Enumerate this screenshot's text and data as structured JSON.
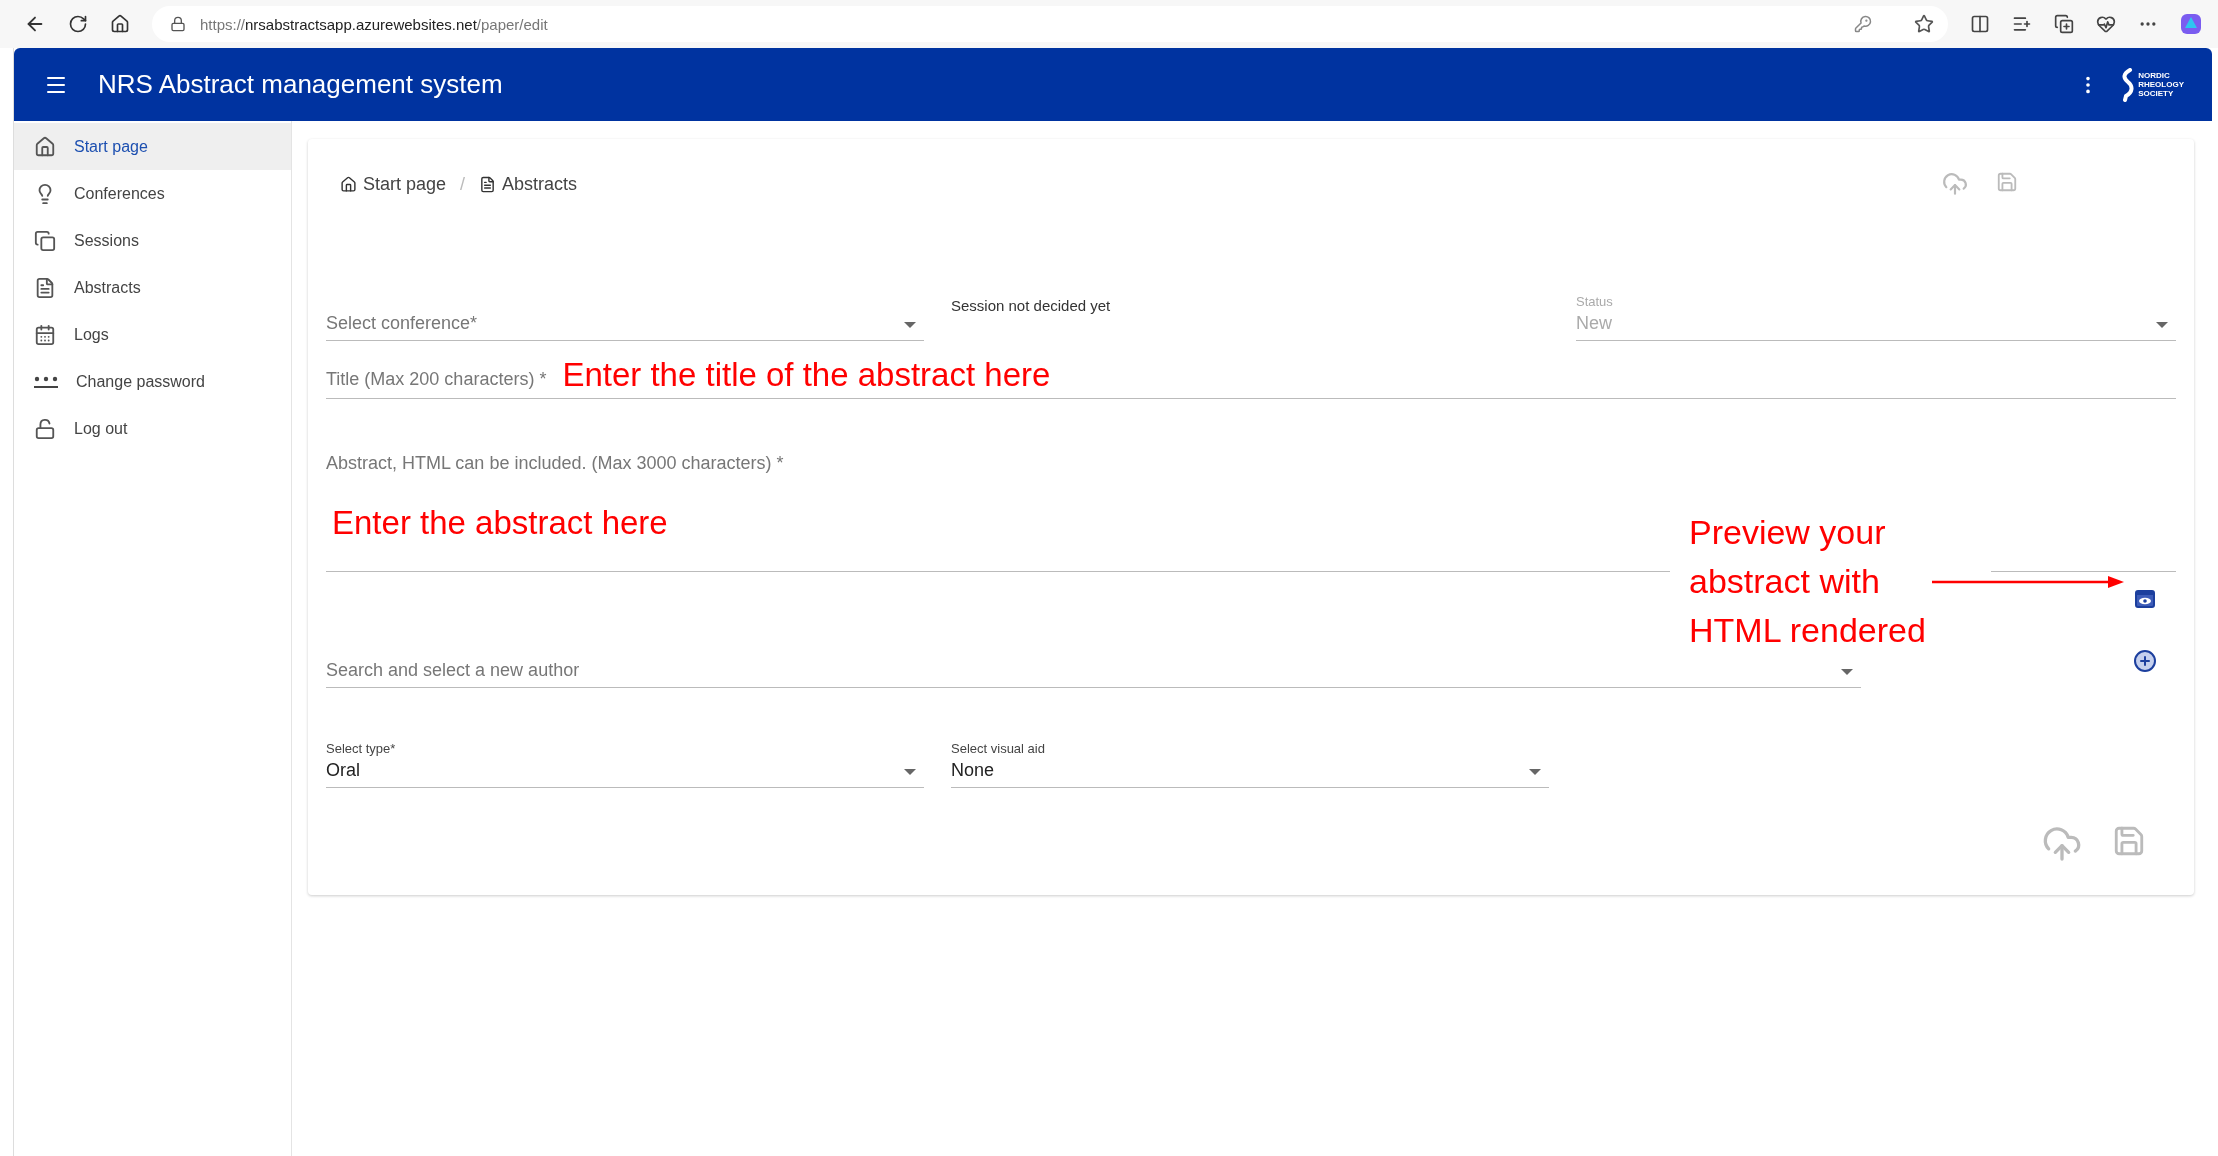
{
  "browser": {
    "url_scheme": "https://",
    "url_host": "nrsabstractsapp.azurewebsites.net",
    "url_path": "/paper/edit"
  },
  "header": {
    "title": "NRS Abstract management system",
    "logo_lines": [
      "NORDIC",
      "RHEOLOGY",
      "SOCIETY"
    ]
  },
  "sidebar": {
    "items": [
      {
        "label": "Start page",
        "selected": true
      },
      {
        "label": "Conferences",
        "selected": false
      },
      {
        "label": "Sessions",
        "selected": false
      },
      {
        "label": "Abstracts",
        "selected": false
      },
      {
        "label": "Logs",
        "selected": false
      },
      {
        "label": "Change password",
        "selected": false
      },
      {
        "label": "Log out",
        "selected": false
      }
    ]
  },
  "breadcrumb": [
    "Start page",
    "Abstracts"
  ],
  "breadcrumb_separator": "/",
  "form": {
    "conference": {
      "placeholder": "Select conference*"
    },
    "session_note": "Session not decided yet",
    "status": {
      "label": "Status",
      "value": "New",
      "disabled": true
    },
    "title": {
      "placeholder": "Title (Max 200 characters) *"
    },
    "abstract": {
      "placeholder": "Abstract, HTML can be included. (Max 3000 characters) *"
    },
    "author": {
      "placeholder": "Search and select a new author"
    },
    "type": {
      "label": "Select type*",
      "value": "Oral"
    },
    "visual_aid": {
      "label": "Select visual aid",
      "value": "None"
    }
  },
  "annotations": [
    {
      "kind": "title",
      "text": "Enter the title of the abstract here"
    },
    {
      "kind": "abstract",
      "text": "Enter the abstract here"
    },
    {
      "kind": "preview",
      "text": "Preview your abstract with HTML rendered"
    }
  ]
}
